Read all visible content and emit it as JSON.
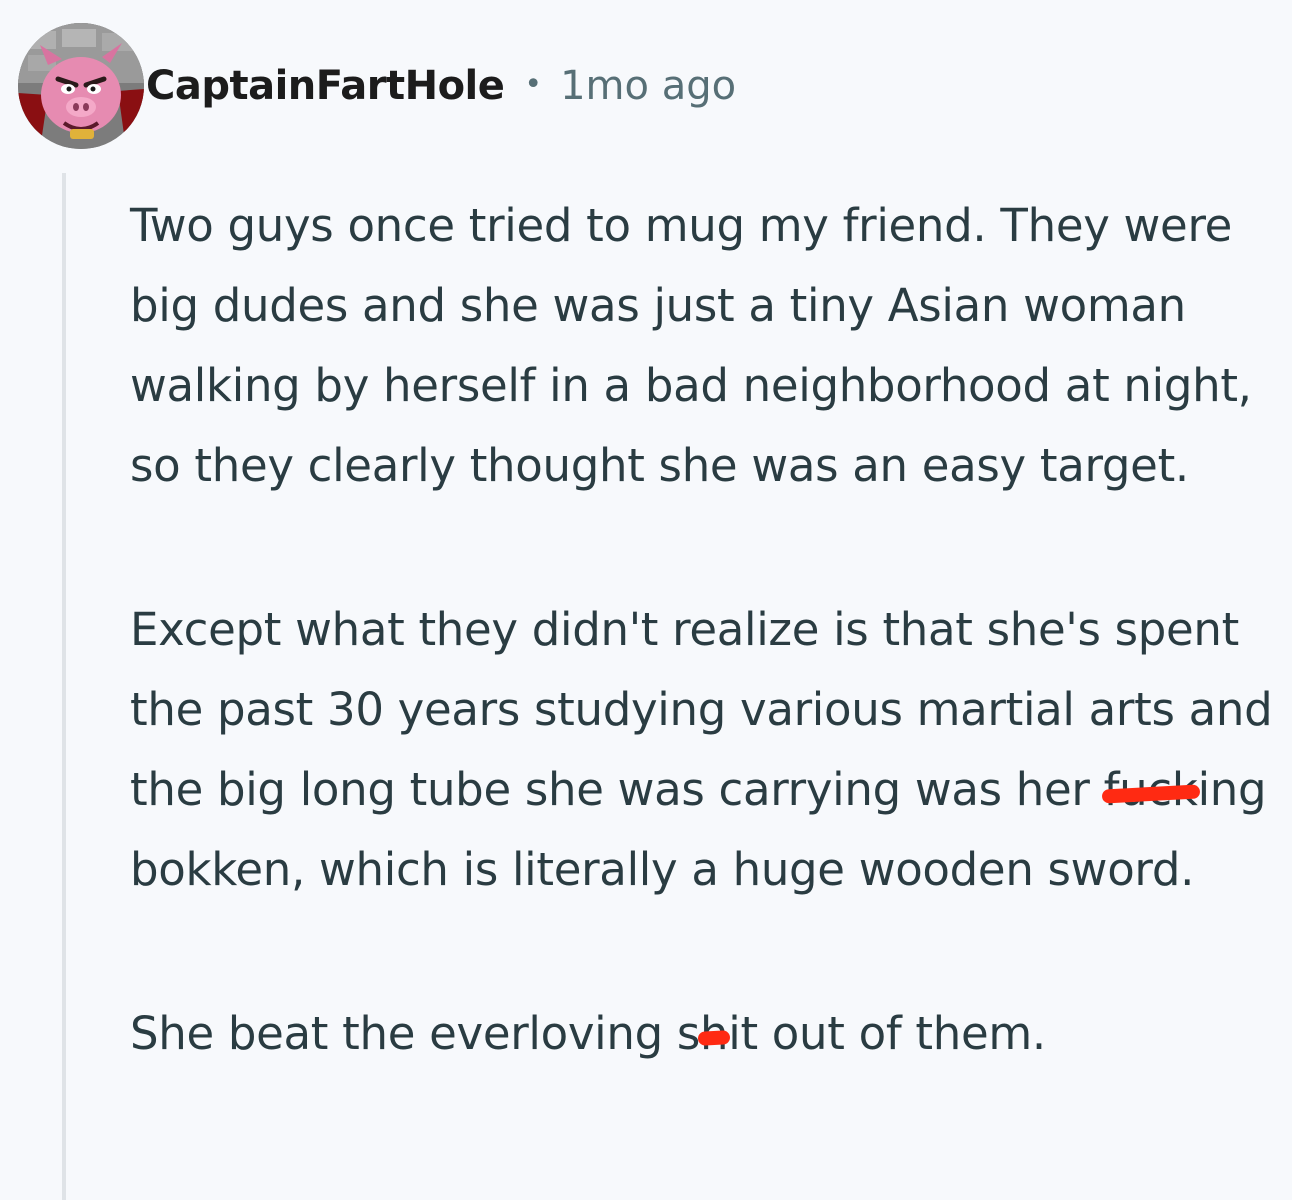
{
  "comment": {
    "author": "CaptainFartHole",
    "separator": "•",
    "timestamp": "1mo ago",
    "avatar_icon": "pig-character-avatar",
    "paragraphs": [
      {
        "segments": [
          {
            "text": "Two guys once tried to mug my friend. They were big dudes and she was just a tiny Asian woman walking by herself in a bad neighborhood at night, so they clearly thought she was an easy target."
          }
        ]
      },
      {
        "segments": [
          {
            "text": "Except what they didn't realize is that she's spent the past 30 years studying various martial arts and the big long tube she was carrying was her "
          },
          {
            "text": "fuck",
            "redacted": true
          },
          {
            "text": "ing bokken, which is literally a huge wooden sword."
          }
        ]
      },
      {
        "segments": [
          {
            "text": "She beat the everloving s"
          },
          {
            "text": "h",
            "redacted": true
          },
          {
            "text": "it out of them."
          }
        ]
      }
    ]
  },
  "colors": {
    "background": "#f7f9fc",
    "body_text": "#2a3c42",
    "meta_text": "#576f76",
    "thread_line": "#dfe3e7",
    "redaction": "#ff2a12"
  }
}
